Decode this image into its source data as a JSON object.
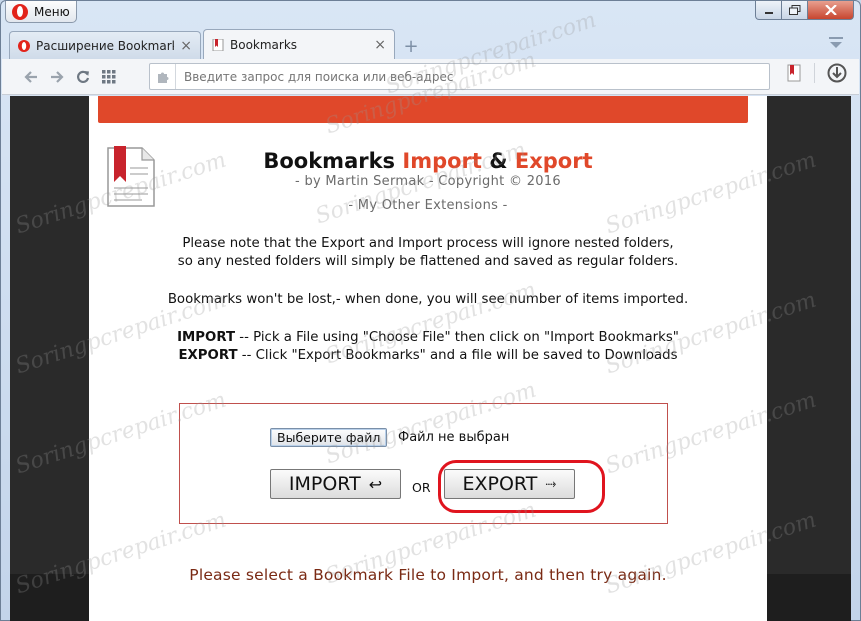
{
  "browser": {
    "menu_label": "Меню",
    "tabs": [
      {
        "title": "Расширение Bookmarks",
        "favicon": "opera-icon"
      },
      {
        "title": "Bookmarks",
        "favicon": "bookmark-icon"
      }
    ],
    "new_tab_symbol": "+",
    "address_placeholder": "Введите запрос для поиска или веб-адрес",
    "colors": {
      "accent": "#e0482a",
      "close_button": "#c7462f"
    }
  },
  "page": {
    "title_part1": "Bookmarks ",
    "title_part2": "Import",
    "title_part3": " & ",
    "title_part4": "Export",
    "byline": "- by Martin Sermak - Copyright © 2016",
    "other_extensions": "- My Other Extensions -",
    "note_line1": "Please note that the Export and Import process will ignore nested folders,",
    "note_line2": "so any nested folders will simply be flattened and saved as regular folders.",
    "lost_line": "Bookmarks won't be lost,- when done, you will see number of items imported.",
    "import_keyword": "IMPORT",
    "import_desc": " -- Pick a File using \"Choose File\" then click on \"Import Bookmarks\"",
    "export_keyword": "EXPORT",
    "export_desc": " -- Click \"Export Bookmarks\" and a file will be saved to Downloads",
    "file_button": "Выберите файл",
    "file_status": "Файл не выбран",
    "import_button": "IMPORT",
    "import_arrow": "↩",
    "or_label": "OR",
    "export_button": "EXPORT",
    "export_arrow": "⤑",
    "status_message": "Please select a Bookmark File to Import, and then try again."
  },
  "watermark": "Soringpcrepair.com"
}
